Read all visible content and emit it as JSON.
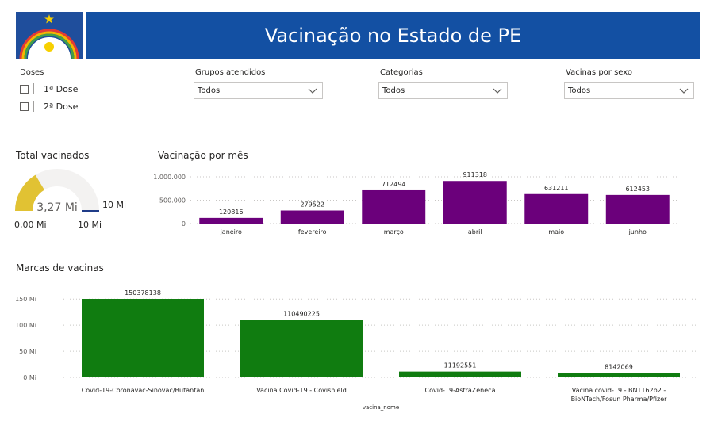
{
  "header": {
    "title": "Vacinação no Estado de PE"
  },
  "doses_slicer": {
    "title": "Doses",
    "options": [
      {
        "label": "1ª Dose",
        "checked": false
      },
      {
        "label": "2ª Dose",
        "checked": false
      }
    ]
  },
  "filters": [
    {
      "title": "Grupos atendidos",
      "value": "Todos"
    },
    {
      "title": "Categorias",
      "value": "Todos"
    },
    {
      "title": "Vacinas por sexo",
      "value": "Todos"
    }
  ],
  "gauge": {
    "title": "Total vacinados",
    "value_label": "3,27 Mi",
    "min_label": "0,00 Mi",
    "max_label": "10 Mi",
    "target_label": "10 Mi",
    "value": 3.27,
    "min": 0,
    "max": 10,
    "target": 10,
    "fill_color": "#e1c233",
    "track_color": "#f3f2f1",
    "target_color": "#1f3c88"
  },
  "chart_data": [
    {
      "type": "bar",
      "title": "Vacinação por mês",
      "categories": [
        "janeiro",
        "fevereiro",
        "março",
        "abril",
        "maio",
        "junho"
      ],
      "values": [
        120816,
        279522,
        712494,
        911318,
        631211,
        612453
      ],
      "data_labels": [
        "120816",
        "279522",
        "712494",
        "911318",
        "631211",
        "612453"
      ],
      "y_ticks": [
        0,
        500000,
        1000000
      ],
      "y_tick_labels": [
        "0",
        "500.000",
        "1.000.000"
      ],
      "ylim": [
        0,
        1000000
      ],
      "grid": true,
      "color": "#6b007b"
    },
    {
      "type": "bar",
      "title": "Marcas de vacinas",
      "xlabel": "vacina_nome",
      "categories": [
        [
          "Covid-19-Coronavac-Sinovac/Butantan"
        ],
        [
          "Vacina Covid-19 - Covishield"
        ],
        [
          "Covid-19-AstraZeneca"
        ],
        [
          "Vacina covid-19 - BNT162b2 -",
          "BioNTech/Fosun Pharma/Pfizer"
        ]
      ],
      "values": [
        150378138,
        110490225,
        11192551,
        8142069
      ],
      "data_labels": [
        "150378138",
        "110490225",
        "11192551",
        "8142069"
      ],
      "y_ticks": [
        0,
        50000000,
        100000000,
        150000000
      ],
      "y_tick_labels": [
        "0 Mi",
        "50 Mi",
        "100 Mi",
        "150 Mi"
      ],
      "ylim": [
        0,
        150378138
      ],
      "grid": true,
      "color": "#107c10"
    }
  ]
}
